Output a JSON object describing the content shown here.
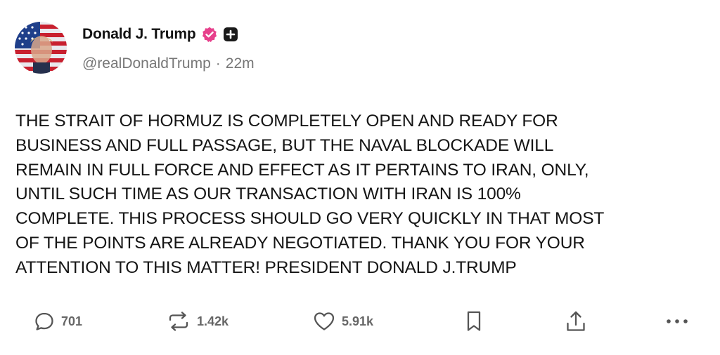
{
  "author": {
    "display_name": "Donald J. Trump",
    "handle": "@realDonaldTrump",
    "time_ago": "22m",
    "separator": "·",
    "verified_color": "#e7408c"
  },
  "post": {
    "text": "THE STRAIT OF HORMUZ IS COMPLETELY OPEN AND READY FOR\nBUSINESS AND FULL PASSAGE, BUT THE NAVAL BLOCKADE WILL\nREMAIN IN FULL FORCE AND EFFECT AS IT PERTAINS TO IRAN, ONLY,\nUNTIL SUCH TIME AS OUR TRANSACTION WITH IRAN IS 100%\nCOMPLETE. THIS PROCESS SHOULD GO VERY QUICKLY IN THAT MOST\nOF THE POINTS ARE ALREADY NEGOTIATED. THANK YOU FOR YOUR\nATTENTION TO THIS MATTER! PRESIDENT DONALD J.TRUMP"
  },
  "actions": {
    "replies": "701",
    "reposts": "1.42k",
    "likes": "5.91k",
    "icons": [
      "reply-icon",
      "repost-icon",
      "like-icon",
      "bookmark-icon",
      "share-icon",
      "more-icon"
    ]
  }
}
